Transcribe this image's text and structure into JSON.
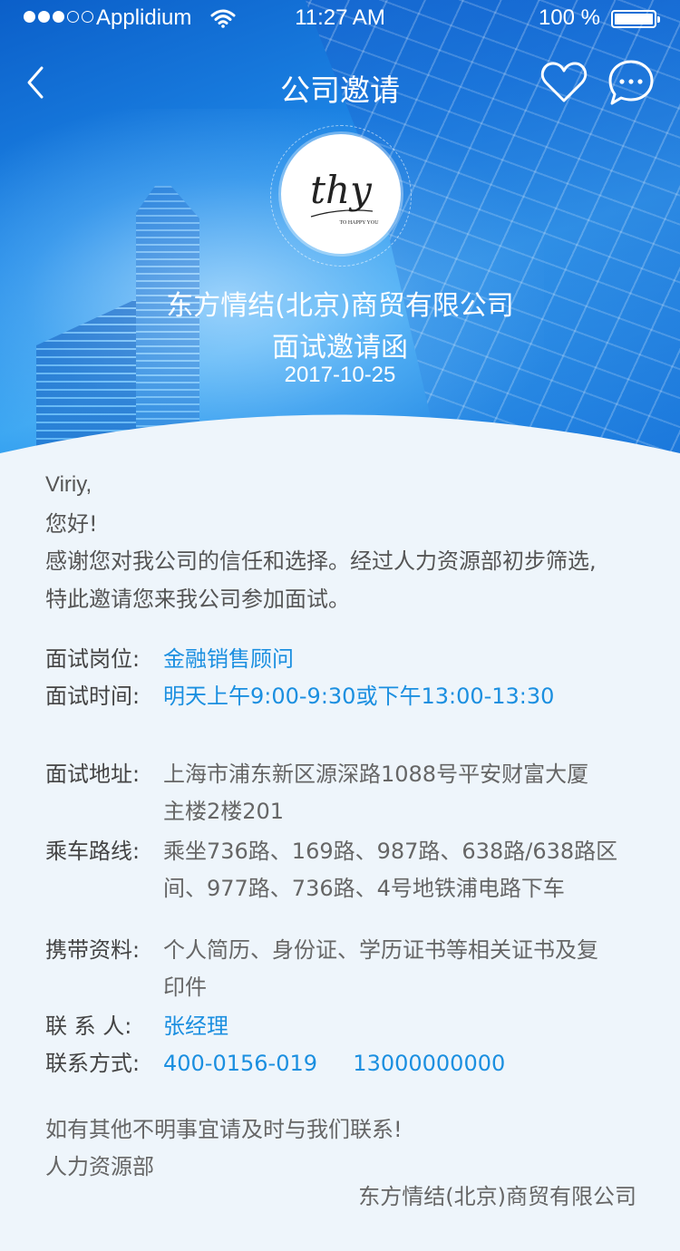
{
  "status_bar": {
    "carrier": "Applidium",
    "time": "11:27 AM",
    "battery": "100 %"
  },
  "nav": {
    "title": "公司邀请",
    "icons": [
      "back-arrow-icon",
      "heart-icon",
      "chat-bubble-icon"
    ]
  },
  "logo": {
    "text": "thy",
    "tagline": "TO HAPPY YOU"
  },
  "header": {
    "company": "东方情结(北京)商贸有限公司",
    "subtitle": "面试邀请函",
    "date": "2017-10-25"
  },
  "letter": {
    "name": "Viriy,",
    "greeting": "您好!",
    "intro_line1": "感谢您对我公司的信任和选择。经过人力资源部初步筛选,",
    "intro_line2": "特此邀请您来我公司参加面试。"
  },
  "details": {
    "position_label": "面试岗位:",
    "position_value": "金融销售顾问",
    "time_label": "面试时间:",
    "time_value": "明天上午9:00-9:30或下午13:00-13:30",
    "address_label": "面试地址:",
    "address_line1": "上海市浦东新区源深路1088号平安财富大厦",
    "address_line2": "主楼2楼201",
    "route_label": "乘车路线:",
    "route_line1": "乘坐736路、169路、987路、638路/638路区",
    "route_line2": "间、977路、736路、4号地铁浦电路下车",
    "materials_label": "携带资料:",
    "materials_line1": "个人简历、身份证、学历证书等相关证书及复",
    "materials_line2": "印件",
    "contact_label": "联 系 人:",
    "contact_value": "张经理",
    "phone_label": "联系方式:",
    "phone_1": "400-0156-019",
    "phone_2": "13000000000"
  },
  "closing": {
    "line1": "如有其他不明事宜请及时与我们联系!",
    "department": "人力资源部",
    "signature": "东方情结(北京)商贸有限公司"
  },
  "colors": {
    "accent": "#1b8fe0",
    "hero_top": "#0b5fc9",
    "hero_mid": "#3aa6f2",
    "background": "#eef5fb"
  }
}
